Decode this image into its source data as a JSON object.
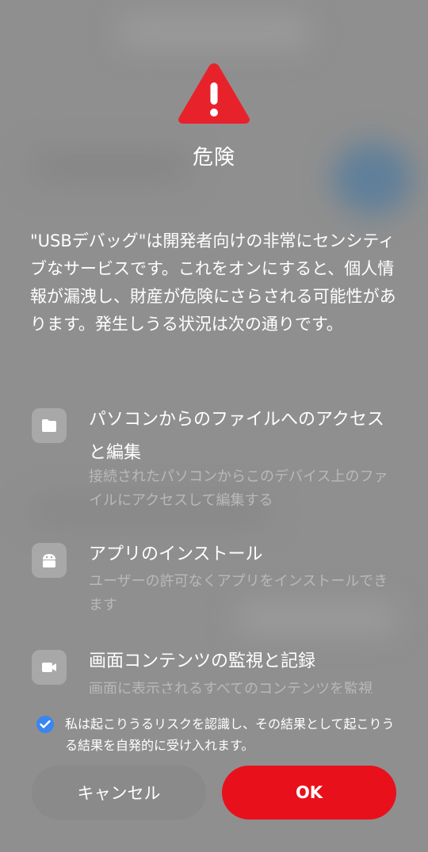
{
  "dialog": {
    "warning_icon": "warning-triangle-icon",
    "title": "危険",
    "description": "\"USBデバッグ\"は開発者向けの非常にセンシティブなサービスです。これをオンにすると、個人情報が漏洩し、財産が危険にさらされる可能性があります。発生しうる状況は次の通りです。",
    "permissions": [
      {
        "icon": "folder-icon",
        "title": "パソコンからのファイルへのアクセスと編集",
        "description": "接続されたパソコンからこのデバイス上のファイルにアクセスして編集する"
      },
      {
        "icon": "android-icon",
        "title": "アプリのインストール",
        "description": "ユーザーの許可なくアプリをインストールできます"
      },
      {
        "icon": "video-camera-icon",
        "title": "画面コンテンツの監視と記録",
        "description": "画面に表示されるすべてのコンテンツを監視"
      }
    ],
    "consent": {
      "checked": true,
      "text": "私は起こりうるリスクを認識し、その結果として起こりうる結果を自発的に受け入れます。"
    },
    "buttons": {
      "cancel_label": "キャンセル",
      "ok_label": "OK"
    }
  },
  "colors": {
    "accent_red": "#e8111b",
    "checkbox_blue": "#3a86f0",
    "background": "#8f8f8f"
  }
}
